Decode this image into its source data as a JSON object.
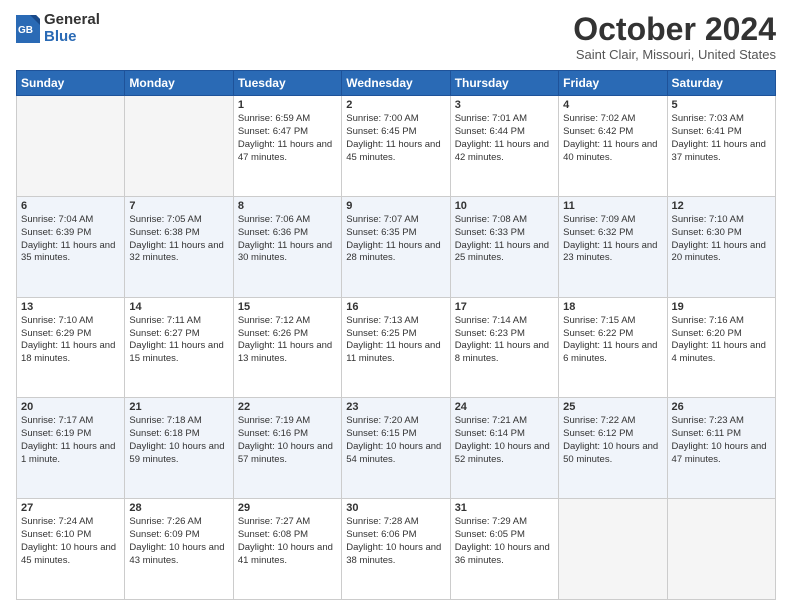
{
  "logo": {
    "general": "General",
    "blue": "Blue"
  },
  "title": "October 2024",
  "location": "Saint Clair, Missouri, United States",
  "days_of_week": [
    "Sunday",
    "Monday",
    "Tuesday",
    "Wednesday",
    "Thursday",
    "Friday",
    "Saturday"
  ],
  "weeks": [
    [
      {
        "day": "",
        "sunrise": "",
        "sunset": "",
        "daylight": ""
      },
      {
        "day": "",
        "sunrise": "",
        "sunset": "",
        "daylight": ""
      },
      {
        "day": "1",
        "sunrise": "Sunrise: 6:59 AM",
        "sunset": "Sunset: 6:47 PM",
        "daylight": "Daylight: 11 hours and 47 minutes."
      },
      {
        "day": "2",
        "sunrise": "Sunrise: 7:00 AM",
        "sunset": "Sunset: 6:45 PM",
        "daylight": "Daylight: 11 hours and 45 minutes."
      },
      {
        "day": "3",
        "sunrise": "Sunrise: 7:01 AM",
        "sunset": "Sunset: 6:44 PM",
        "daylight": "Daylight: 11 hours and 42 minutes."
      },
      {
        "day": "4",
        "sunrise": "Sunrise: 7:02 AM",
        "sunset": "Sunset: 6:42 PM",
        "daylight": "Daylight: 11 hours and 40 minutes."
      },
      {
        "day": "5",
        "sunrise": "Sunrise: 7:03 AM",
        "sunset": "Sunset: 6:41 PM",
        "daylight": "Daylight: 11 hours and 37 minutes."
      }
    ],
    [
      {
        "day": "6",
        "sunrise": "Sunrise: 7:04 AM",
        "sunset": "Sunset: 6:39 PM",
        "daylight": "Daylight: 11 hours and 35 minutes."
      },
      {
        "day": "7",
        "sunrise": "Sunrise: 7:05 AM",
        "sunset": "Sunset: 6:38 PM",
        "daylight": "Daylight: 11 hours and 32 minutes."
      },
      {
        "day": "8",
        "sunrise": "Sunrise: 7:06 AM",
        "sunset": "Sunset: 6:36 PM",
        "daylight": "Daylight: 11 hours and 30 minutes."
      },
      {
        "day": "9",
        "sunrise": "Sunrise: 7:07 AM",
        "sunset": "Sunset: 6:35 PM",
        "daylight": "Daylight: 11 hours and 28 minutes."
      },
      {
        "day": "10",
        "sunrise": "Sunrise: 7:08 AM",
        "sunset": "Sunset: 6:33 PM",
        "daylight": "Daylight: 11 hours and 25 minutes."
      },
      {
        "day": "11",
        "sunrise": "Sunrise: 7:09 AM",
        "sunset": "Sunset: 6:32 PM",
        "daylight": "Daylight: 11 hours and 23 minutes."
      },
      {
        "day": "12",
        "sunrise": "Sunrise: 7:10 AM",
        "sunset": "Sunset: 6:30 PM",
        "daylight": "Daylight: 11 hours and 20 minutes."
      }
    ],
    [
      {
        "day": "13",
        "sunrise": "Sunrise: 7:10 AM",
        "sunset": "Sunset: 6:29 PM",
        "daylight": "Daylight: 11 hours and 18 minutes."
      },
      {
        "day": "14",
        "sunrise": "Sunrise: 7:11 AM",
        "sunset": "Sunset: 6:27 PM",
        "daylight": "Daylight: 11 hours and 15 minutes."
      },
      {
        "day": "15",
        "sunrise": "Sunrise: 7:12 AM",
        "sunset": "Sunset: 6:26 PM",
        "daylight": "Daylight: 11 hours and 13 minutes."
      },
      {
        "day": "16",
        "sunrise": "Sunrise: 7:13 AM",
        "sunset": "Sunset: 6:25 PM",
        "daylight": "Daylight: 11 hours and 11 minutes."
      },
      {
        "day": "17",
        "sunrise": "Sunrise: 7:14 AM",
        "sunset": "Sunset: 6:23 PM",
        "daylight": "Daylight: 11 hours and 8 minutes."
      },
      {
        "day": "18",
        "sunrise": "Sunrise: 7:15 AM",
        "sunset": "Sunset: 6:22 PM",
        "daylight": "Daylight: 11 hours and 6 minutes."
      },
      {
        "day": "19",
        "sunrise": "Sunrise: 7:16 AM",
        "sunset": "Sunset: 6:20 PM",
        "daylight": "Daylight: 11 hours and 4 minutes."
      }
    ],
    [
      {
        "day": "20",
        "sunrise": "Sunrise: 7:17 AM",
        "sunset": "Sunset: 6:19 PM",
        "daylight": "Daylight: 11 hours and 1 minute."
      },
      {
        "day": "21",
        "sunrise": "Sunrise: 7:18 AM",
        "sunset": "Sunset: 6:18 PM",
        "daylight": "Daylight: 10 hours and 59 minutes."
      },
      {
        "day": "22",
        "sunrise": "Sunrise: 7:19 AM",
        "sunset": "Sunset: 6:16 PM",
        "daylight": "Daylight: 10 hours and 57 minutes."
      },
      {
        "day": "23",
        "sunrise": "Sunrise: 7:20 AM",
        "sunset": "Sunset: 6:15 PM",
        "daylight": "Daylight: 10 hours and 54 minutes."
      },
      {
        "day": "24",
        "sunrise": "Sunrise: 7:21 AM",
        "sunset": "Sunset: 6:14 PM",
        "daylight": "Daylight: 10 hours and 52 minutes."
      },
      {
        "day": "25",
        "sunrise": "Sunrise: 7:22 AM",
        "sunset": "Sunset: 6:12 PM",
        "daylight": "Daylight: 10 hours and 50 minutes."
      },
      {
        "day": "26",
        "sunrise": "Sunrise: 7:23 AM",
        "sunset": "Sunset: 6:11 PM",
        "daylight": "Daylight: 10 hours and 47 minutes."
      }
    ],
    [
      {
        "day": "27",
        "sunrise": "Sunrise: 7:24 AM",
        "sunset": "Sunset: 6:10 PM",
        "daylight": "Daylight: 10 hours and 45 minutes."
      },
      {
        "day": "28",
        "sunrise": "Sunrise: 7:26 AM",
        "sunset": "Sunset: 6:09 PM",
        "daylight": "Daylight: 10 hours and 43 minutes."
      },
      {
        "day": "29",
        "sunrise": "Sunrise: 7:27 AM",
        "sunset": "Sunset: 6:08 PM",
        "daylight": "Daylight: 10 hours and 41 minutes."
      },
      {
        "day": "30",
        "sunrise": "Sunrise: 7:28 AM",
        "sunset": "Sunset: 6:06 PM",
        "daylight": "Daylight: 10 hours and 38 minutes."
      },
      {
        "day": "31",
        "sunrise": "Sunrise: 7:29 AM",
        "sunset": "Sunset: 6:05 PM",
        "daylight": "Daylight: 10 hours and 36 minutes."
      },
      {
        "day": "",
        "sunrise": "",
        "sunset": "",
        "daylight": ""
      },
      {
        "day": "",
        "sunrise": "",
        "sunset": "",
        "daylight": ""
      }
    ]
  ]
}
